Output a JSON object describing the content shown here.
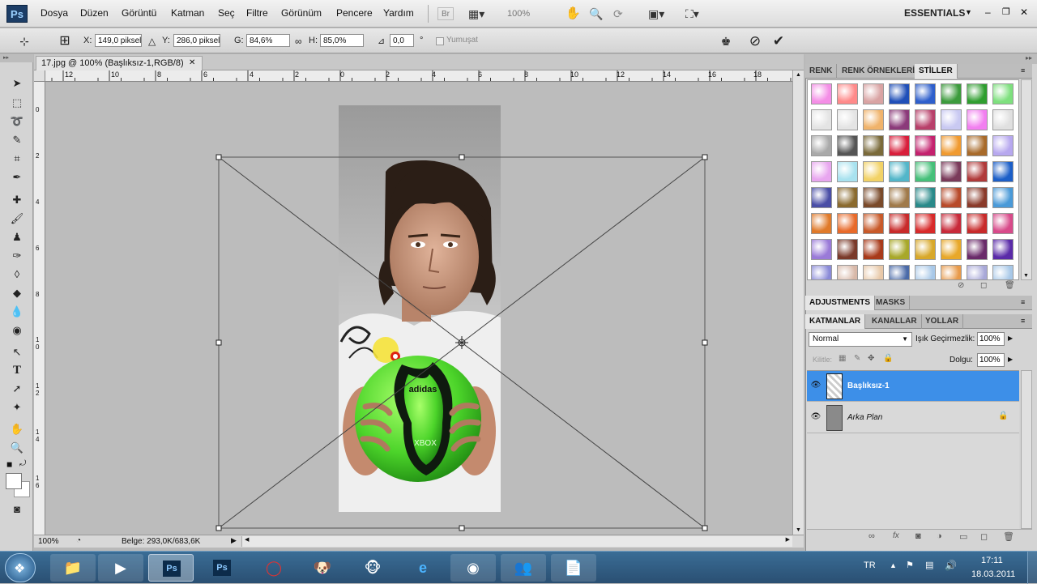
{
  "menubar": {
    "app_logo": "Ps",
    "items": [
      "Dosya",
      "Düzen",
      "Görüntü",
      "Katman",
      "Seç",
      "Filtre",
      "Görünüm",
      "Pencere",
      "Yardım"
    ],
    "br_label": "Br",
    "zoom_label": "100%",
    "workspace": "ESSENTIALS"
  },
  "options": {
    "x_label": "X:",
    "x_value": "149,0 piksel",
    "y_label": "Y:",
    "y_value": "286,0 piksel",
    "w_label": "G:",
    "w_value": "84,6%",
    "h_label": "H:",
    "h_value": "85,0%",
    "angle_value": "0,0",
    "degree": "°",
    "smooth_label": "Yumuşat"
  },
  "document": {
    "tab_title": "17.jpg @ 100% (Başlıksız-1,RGB/8)",
    "close_glyph": "✕",
    "ruler_h": [
      "12",
      "10",
      "8",
      "6",
      "4",
      "2",
      "0",
      "2",
      "4",
      "6",
      "8",
      "10",
      "12",
      "14",
      "16",
      "18"
    ],
    "ruler_v": [
      "0",
      "2",
      "4",
      "6",
      "8",
      "1 0",
      "1 2",
      "1 4",
      "1 6"
    ],
    "zoom": "100%",
    "status": "Belge: 293,0K/683,6K",
    "ball_brand": "adidas",
    "ball_sponsor": "XBOX"
  },
  "panels": {
    "styles_tabs": [
      "RENK",
      "RENK ÖRNEKLERİ",
      "STİLLER"
    ],
    "adjust_tabs": [
      "ADJUSTMENTS",
      "MASKS"
    ],
    "layer_tabs": [
      "KATMANLAR",
      "KANALLAR",
      "YOLLAR"
    ],
    "blend_mode": "Normal",
    "opacity_label": "Işık Geçirmezlik:",
    "opacity_value": "100%",
    "lock_label": "Kilitle:",
    "fill_label": "Dolgu:",
    "fill_value": "100%",
    "layers": [
      {
        "name": "Başlıksız-1",
        "selected": true
      },
      {
        "name": "Arka Plan",
        "selected": false
      }
    ]
  },
  "taskbar": {
    "lang": "TR",
    "time": "17:11",
    "date": "18.03.2011",
    "apps": [
      "windows-explorer",
      "media-player",
      "photoshop",
      "photoshop",
      "opera",
      "game",
      "monkey",
      "internet-explorer",
      "chrome",
      "messenger",
      "wordpad"
    ]
  },
  "colors": {
    "layer_selected": "#3d8fe8",
    "ball_green": "#4cd42a"
  }
}
